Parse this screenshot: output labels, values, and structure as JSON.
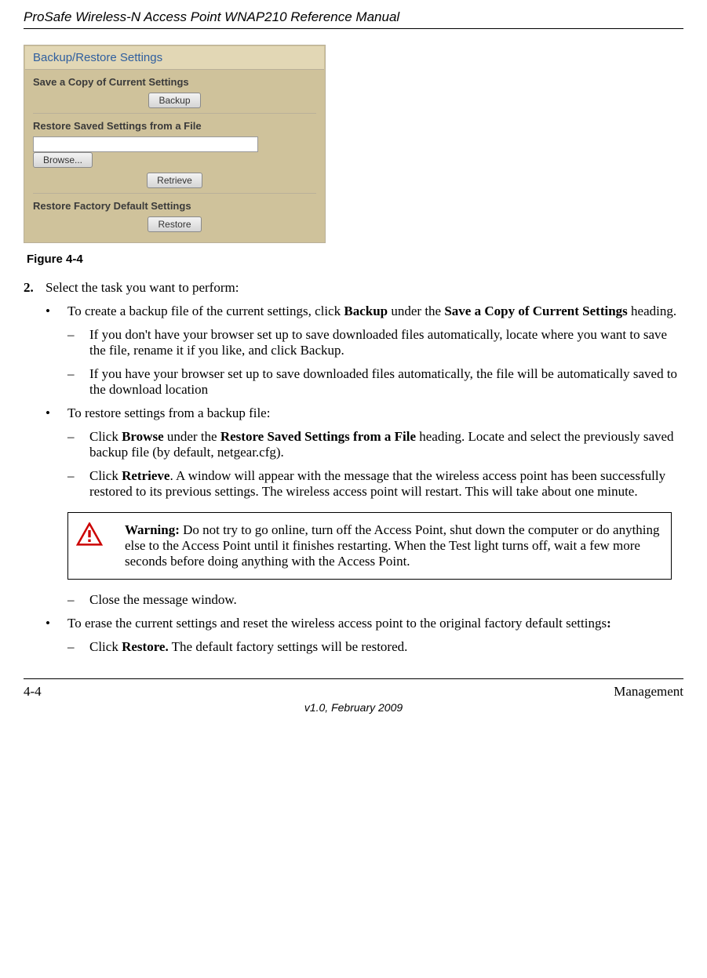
{
  "header": {
    "title": "ProSafe Wireless-N Access Point WNAP210 Reference Manual"
  },
  "screenshot": {
    "panel_title": "Backup/Restore Settings",
    "save_label": "Save a Copy of Current Settings",
    "backup_btn": "Backup",
    "restore_file_label": "Restore Saved Settings from a File",
    "browse_btn": "Browse...",
    "retrieve_btn": "Retrieve",
    "factory_label": "Restore Factory Default Settings",
    "restore_btn": "Restore"
  },
  "figure_caption": "Figure 4-4",
  "step2": {
    "num": "2.",
    "text": "Select the task you want to perform:"
  },
  "bullet1": {
    "pre": "To create a backup file of the current settings, click ",
    "b1": "Backup",
    "mid": " under the ",
    "b2": "Save a Copy of Current Settings",
    "post": " heading."
  },
  "bullet1_sub1": "If you don't have your browser set up to save downloaded files automatically, locate where you want to save the file, rename it if you like, and click Backup.",
  "bullet1_sub2": "If you have your browser set up to save downloaded files automatically, the file will be automatically saved to the download location",
  "bullet2": "To restore settings from a backup file:",
  "bullet2_sub1": {
    "pre": "Click ",
    "b1": "Browse",
    "mid": " under the ",
    "b2": "Restore Saved Settings from a File",
    "post": " heading. Locate and select the previously saved backup file (by default, netgear.cfg)."
  },
  "bullet2_sub2": {
    "pre": "Click ",
    "b1": "Retrieve",
    "post": ". A window will appear with the message that the wireless access point has been successfully restored to its previous settings. The wireless access point will restart. This will take about one minute."
  },
  "warning": {
    "label": "Warning:",
    "text": " Do not try to go online, turn off the Access Point, shut down the computer or do anything else to the Access Point until it finishes restarting. When the Test light turns off, wait a few more seconds before doing anything with the Access Point."
  },
  "bullet2_sub3": "Close the message window.",
  "bullet3": {
    "pre": "To erase the current settings and reset the wireless access point to the original factory default settings",
    "b1": ":"
  },
  "bullet3_sub1": {
    "pre": "Click ",
    "b1": "Restore.",
    "post": " The default factory settings will be restored."
  },
  "footer": {
    "left": "4-4",
    "right": "Management",
    "center": "v1.0, February 2009"
  }
}
